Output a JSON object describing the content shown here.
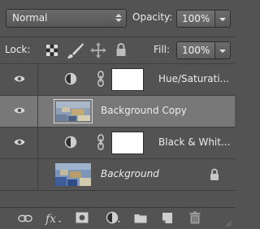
{
  "top": {
    "blend_mode": "Normal",
    "opacity_label": "Opacity:",
    "opacity_value": "100%",
    "lock_label": "Lock:",
    "fill_label": "Fill:",
    "fill_value": "100%"
  },
  "layers": [
    {
      "name": "Hue/Saturati...",
      "type": "adjustment",
      "visible": true,
      "selected": false,
      "italic": false,
      "locked": false
    },
    {
      "name": "Background Copy",
      "type": "image",
      "visible": true,
      "selected": true,
      "italic": false,
      "locked": false
    },
    {
      "name": "Black & Whit...",
      "type": "adjustment",
      "visible": true,
      "selected": false,
      "italic": false,
      "locked": false
    },
    {
      "name": "Background",
      "type": "image",
      "visible": false,
      "selected": false,
      "italic": true,
      "locked": true
    }
  ],
  "icons": {
    "lock_buttons": [
      "lock-transparent-pixels-icon",
      "lock-image-pixels-icon",
      "lock-position-icon",
      "lock-all-icon"
    ],
    "bottom_bar": [
      "link-layers-icon",
      "layer-style-fx-icon",
      "add-mask-icon",
      "adjustment-layer-icon",
      "new-group-icon",
      "new-layer-icon",
      "delete-layer-icon"
    ]
  },
  "colors": {
    "panel_bg": "#535353",
    "selected_row": "#787878",
    "text": "#ececec"
  }
}
